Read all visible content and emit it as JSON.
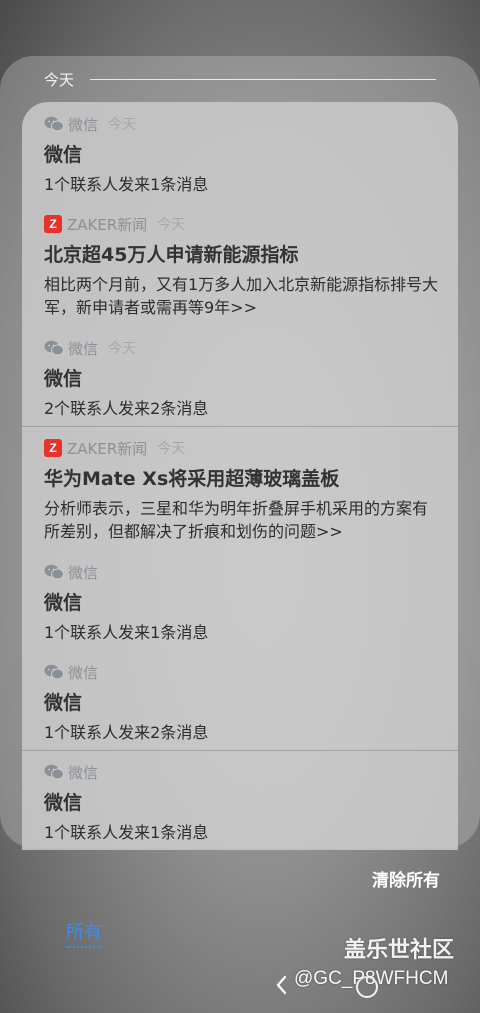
{
  "section": {
    "title": "今天"
  },
  "notifications": [
    {
      "icon": "wechat-icon",
      "app": "微信",
      "time": "今天",
      "title": "微信",
      "body": "1个联系人发来1条消息"
    },
    {
      "icon": "zaker-icon",
      "icon_letter": "Z",
      "app": "ZAKER新闻",
      "time": "今天",
      "title": "北京超45万人申请新能源指标",
      "body": "相比两个月前，又有1万多人加入北京新能源指标排号大军，新申请者或需再等9年>>"
    },
    {
      "icon": "wechat-icon",
      "app": "微信",
      "time": "今天",
      "title": "微信",
      "body": "2个联系人发来2条消息"
    },
    {
      "icon": "zaker-icon",
      "icon_letter": "Z",
      "app": "ZAKER新闻",
      "time": "今天",
      "title": "华为Mate Xs将采用超薄玻璃盖板",
      "body": "分析师表示，三星和华为明年折叠屏手机采用的方案有所差别，但都解决了折痕和划伤的问题>>"
    },
    {
      "icon": "wechat-icon",
      "app": "微信",
      "time": "",
      "title": "微信",
      "body": "1个联系人发来1条消息"
    },
    {
      "icon": "wechat-icon",
      "app": "微信",
      "time": "",
      "title": "微信",
      "body": "1个联系人发来2条消息"
    },
    {
      "icon": "wechat-icon",
      "app": "微信",
      "time": "",
      "title": "微信",
      "body": "1个联系人发来1条消息"
    }
  ],
  "actions": {
    "clear_all": "清除所有"
  },
  "tabs": {
    "all": "所有"
  },
  "watermark": {
    "site": "盖乐世社区",
    "user": "@GC_P8WFHCM"
  },
  "colors": {
    "accent": "#3b8df0",
    "zaker_red": "#e8322a",
    "wechat_gray": "#8a9096"
  }
}
